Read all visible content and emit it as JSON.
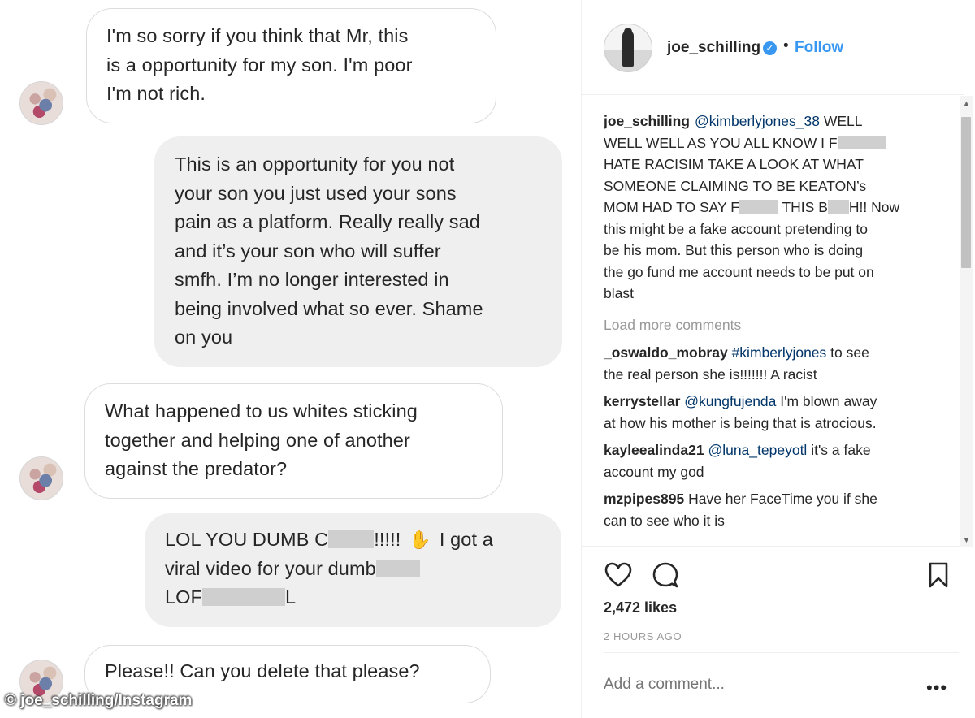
{
  "conversation": {
    "messages": [
      {
        "direction": "in",
        "lines": [
          "I'm so sorry if you think that Mr, this",
          "is a opportunity for my son. I'm poor",
          "I'm not rich."
        ]
      },
      {
        "direction": "out",
        "lines": [
          "This is an opportunity for you not",
          "your son you just used your sons",
          "pain as a platform. Really really sad",
          "and it’s your son who will suffer",
          "smfh.  I’m no longer interested in",
          "being involved what so ever. Shame",
          "on you"
        ]
      },
      {
        "direction": "in",
        "lines": [
          "What happened to us whites sticking",
          "together and helping one of another",
          "against the predator?"
        ]
      },
      {
        "direction": "out",
        "line1_a": "LOL YOU DUMB C",
        "line1_b": "!!!!!",
        "line1_c": "I got a",
        "line2_a": "viral video for your dumb",
        "line3_a": "LOF",
        "line3_b": "L"
      },
      {
        "direction": "in",
        "lines": [
          "Please!! Can you delete that please?"
        ]
      }
    ],
    "watermark": "© joe_schilling/Instagram"
  },
  "post": {
    "username": "joe_schilling",
    "follow_label": "Follow",
    "separator": "•",
    "caption": {
      "user": "joe_schilling",
      "mention": "@kimberlyjones_38",
      "l1_rest": " WELL",
      "l2_a": "WELL WELL AS YOU ALL KNOW I F",
      "l3": "HATE RACISIM TAKE A LOOK AT WHAT",
      "l4": "SOMEONE CLAIMING TO BE KEATON’s",
      "l5_a": "MOM HAD TO SAY F",
      "l5_b": " THIS B",
      "l5_c": "H!! Now",
      "l6": "this might be a fake account pretending to",
      "l7": "be his mom. But this person who is doing",
      "l8": "the go fund me account needs to be put on",
      "l9": "blast"
    },
    "load_more": "Load more comments",
    "comments": [
      {
        "user": "_oswaldo_mobray",
        "mention": "#kimberlyjones",
        "rest1": " to see",
        "line2": "the real person she is!!!!!!! A racist"
      },
      {
        "user": "kerrystellar",
        "mention": "@kungfujenda",
        "rest1": " I'm blown away",
        "line2": "at how his mother is being that is atrocious."
      },
      {
        "user": "kayleealinda21",
        "mention": "@luna_tepeyotl",
        "rest1": " it's a fake",
        "line2": "account my god"
      },
      {
        "user": "mzpipes895",
        "mention": "",
        "rest1": "Have her FaceTime you if she",
        "line2": "can to see who it is"
      }
    ],
    "likes": "2,472 likes",
    "timestamp": "2 HOURS AGO",
    "add_comment_placeholder": "Add a comment...",
    "more_label": "•••",
    "icons": {
      "like": "heart-icon",
      "comment": "speech-bubble-icon",
      "save": "bookmark-icon",
      "verified": "verified-badge-icon"
    },
    "colors": {
      "link_blue": "#3897f0",
      "mention_blue": "#003569",
      "muted_gray": "#999999",
      "outgoing_bubble": "#efefef"
    }
  }
}
